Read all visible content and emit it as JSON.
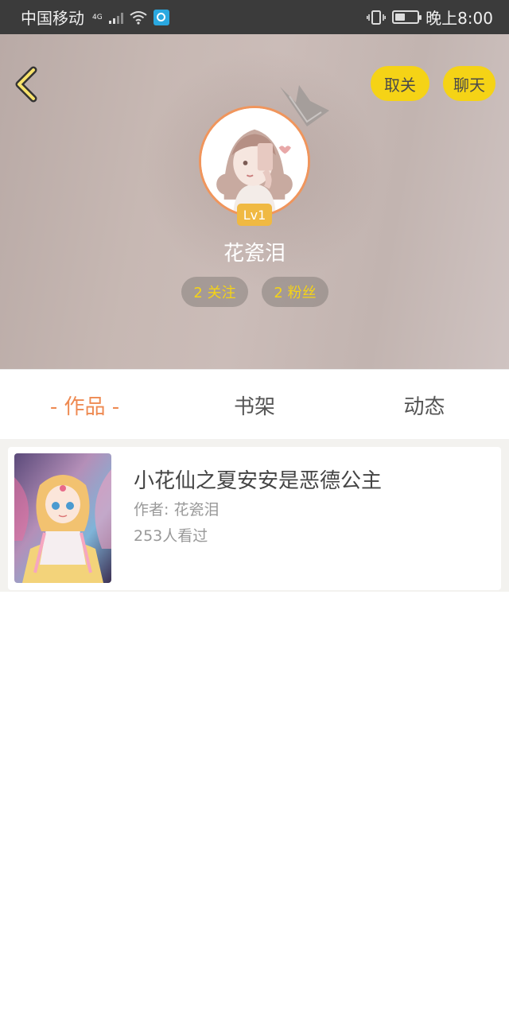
{
  "status_bar": {
    "carrier": "中国移动",
    "network_type": "4G",
    "time": "晚上8:00",
    "battery_level": 0.45,
    "icons": [
      "signal-icon",
      "wifi-icon",
      "app-notification-icon",
      "vibrate-icon",
      "battery-icon"
    ]
  },
  "header": {
    "back_icon": "chevron-left-icon",
    "unfollow_label": "取关",
    "chat_label": "聊天",
    "accent_color": "#f5d316"
  },
  "profile": {
    "level": "Lv1",
    "username": "花瓷泪",
    "following": "2 关注",
    "followers": "2 粉丝",
    "avatar": "avatar-anime-girl",
    "crown_icon": "crown-icon"
  },
  "tabs": [
    {
      "label": "- 作品 -",
      "active": true
    },
    {
      "label": "书架",
      "active": false
    },
    {
      "label": "动态",
      "active": false
    }
  ],
  "works": [
    {
      "title": "小花仙之夏安安是恶德公主",
      "author": "作者: 花瓷泪",
      "views": "253人看过",
      "cover": "cover-fairy-illustration"
    }
  ],
  "colors": {
    "tab_active": "#ee8a52",
    "level_badge": "#f0b942",
    "avatar_ring": "#f0955c"
  }
}
